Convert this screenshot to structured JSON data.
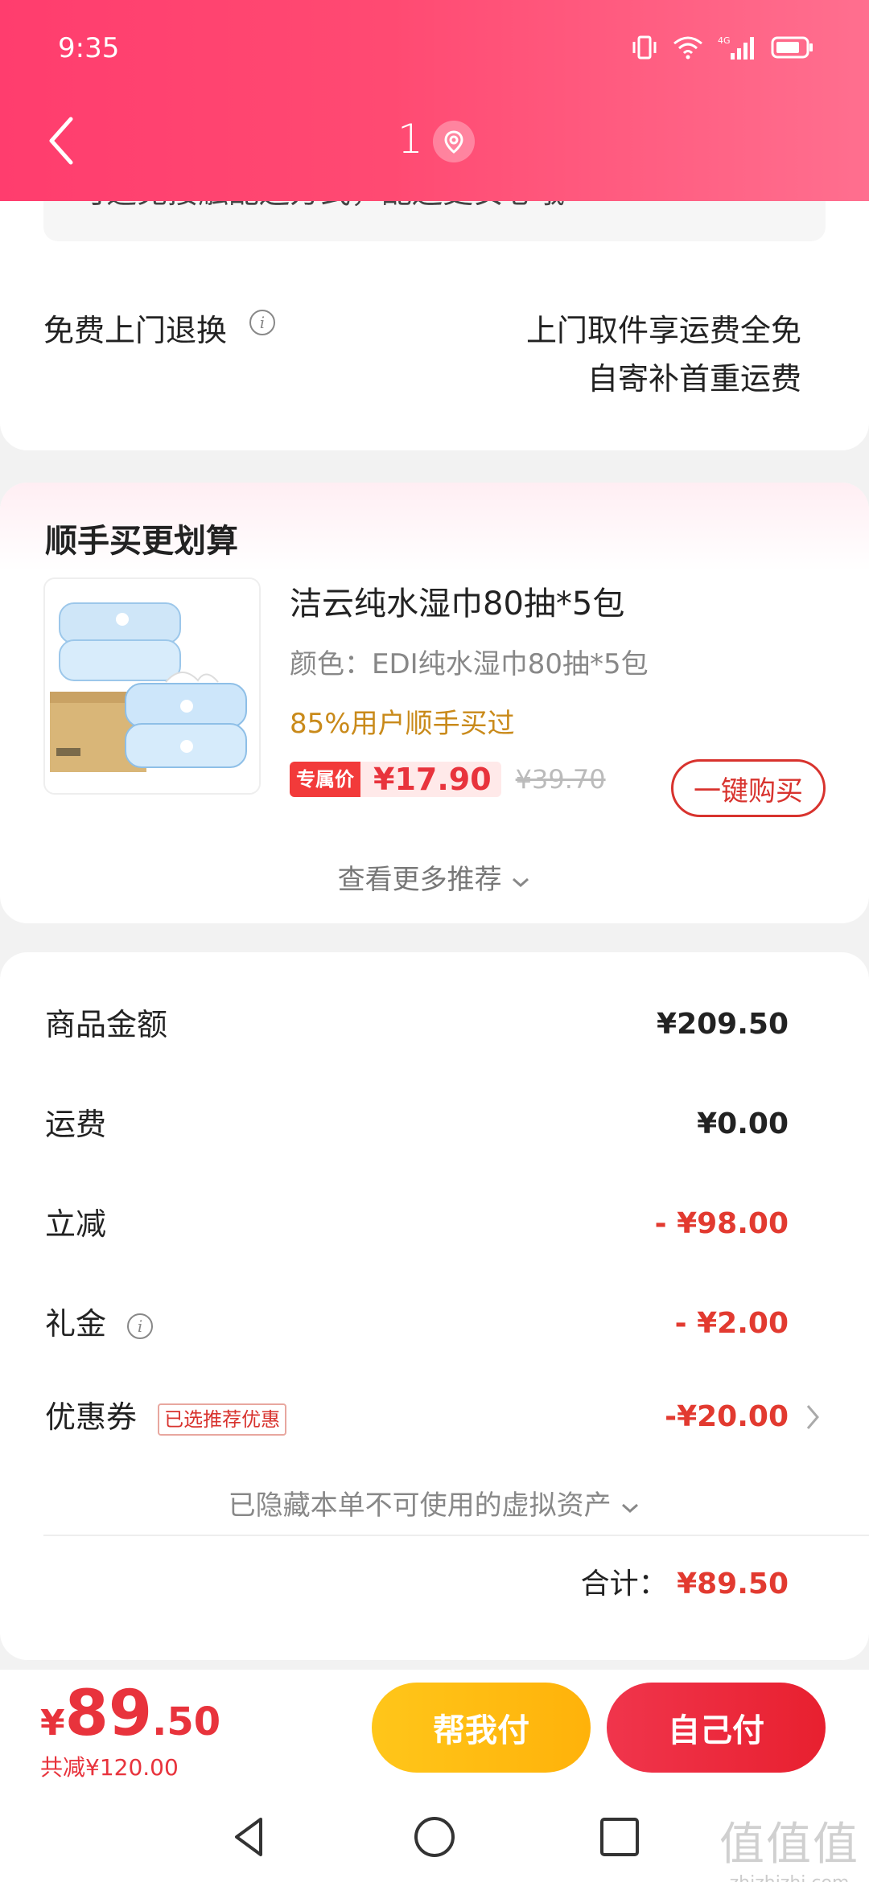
{
  "status_bar": {
    "time": "9:35",
    "network": "4G"
  },
  "header": {
    "title": "1"
  },
  "return_card": {
    "notice": "可选免接触配送方式，配送更安心哦",
    "label": "免费上门退换",
    "right_line1": "上门取件享运费全免",
    "right_line2": "自寄补首重运费"
  },
  "recommend": {
    "title": "顺手买更划算",
    "product": {
      "name": "洁云纯水湿巾80抽*5包",
      "color": "颜色：EDI纯水湿巾80抽*5包",
      "bought": "85%用户顺手买过",
      "tag": "专属价",
      "price": "¥17.90",
      "old_price": "¥39.70",
      "buy_label": "一键购买"
    },
    "more": "查看更多推荐"
  },
  "summary": {
    "rows": [
      {
        "label": "商品金额",
        "value": "¥209.50"
      },
      {
        "label": "运费",
        "value": "¥0.00"
      },
      {
        "label": "立减",
        "value": "- ¥98.00"
      },
      {
        "label": "礼金",
        "value": "- ¥2.00"
      },
      {
        "label": "优惠券",
        "value": "-¥20.00"
      }
    ],
    "coupon_tag": "已选推荐优惠",
    "hidden_assets": "已隐藏本单不可使用的虚拟资产",
    "total_label": "合计：",
    "total_value": "¥89.50"
  },
  "bottom": {
    "currency": "¥",
    "pay_int": "89",
    "pay_dec": ".50",
    "saved": "共减¥120.00",
    "help_pay": "帮我付",
    "self_pay": "自己付"
  },
  "watermark": {
    "big": "值值值",
    "small": "zhizhizhi.com"
  },
  "colors": {
    "brand": "#ff3d6e",
    "price_red": "#e23a30",
    "help_yellow": "#ffc61a"
  }
}
